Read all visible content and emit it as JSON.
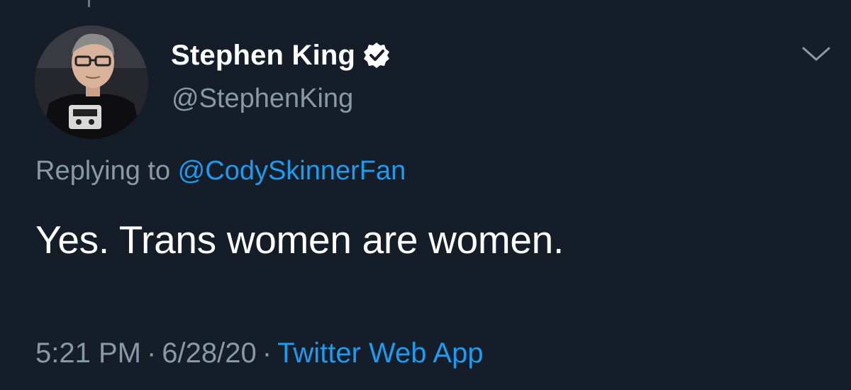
{
  "author": {
    "display_name": "Stephen King",
    "handle": "@StephenKing",
    "verified": true,
    "avatar_icon": "profile-photo"
  },
  "reply": {
    "prefix": "Replying to ",
    "to_handle": "@CodySkinnerFan"
  },
  "tweet": {
    "text": "Yes. Trans women are women."
  },
  "meta": {
    "time": "5:21 PM",
    "separator_1": "·",
    "date": "6/28/20",
    "separator_2": "·",
    "source": "Twitter Web App"
  },
  "icons": {
    "verified": "verified-badge-icon",
    "menu": "chevron-down-icon"
  },
  "colors": {
    "background": "#151d28",
    "text_primary": "#ffffff",
    "text_secondary": "#8899a6",
    "accent": "#1d9bf0"
  }
}
